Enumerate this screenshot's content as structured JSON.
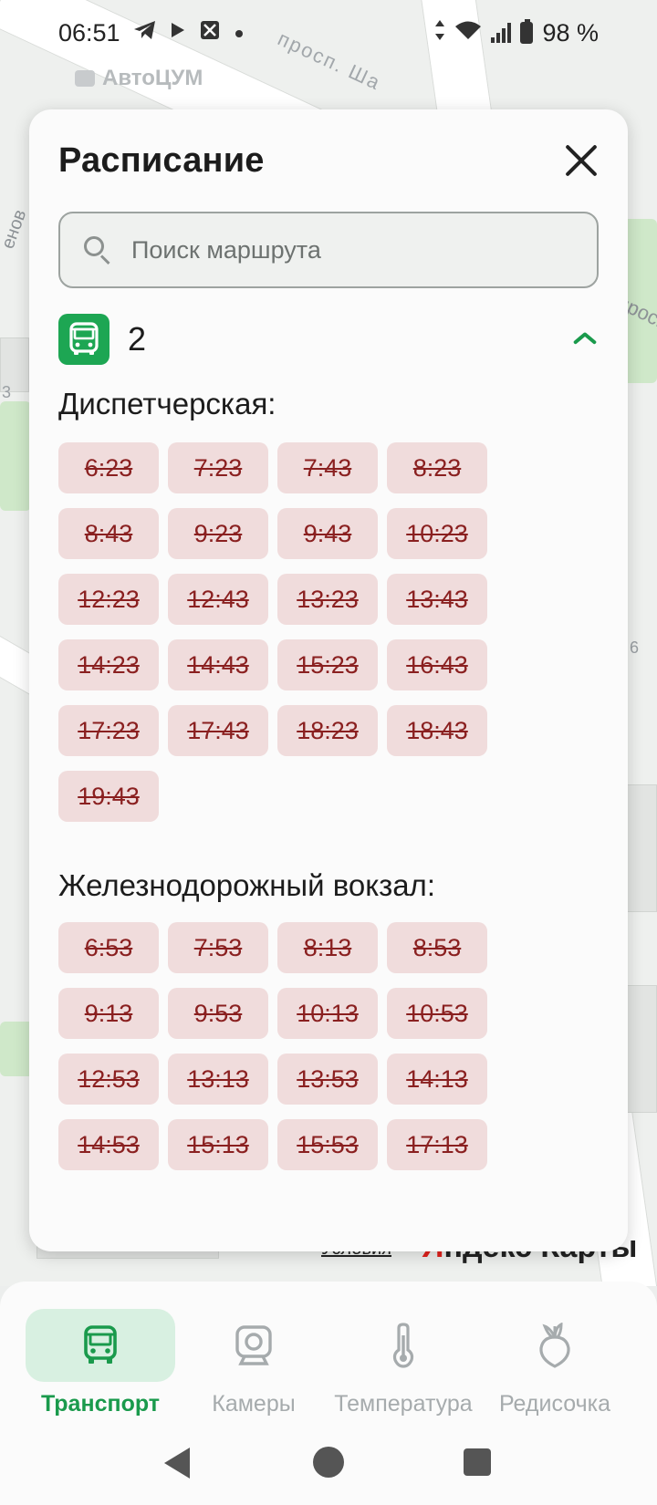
{
  "status_bar": {
    "time": "06:51",
    "battery": "98 %",
    "icons": [
      "telegram-icon",
      "play-icon",
      "crossed-box-icon",
      "dot-icon",
      "data-arrows-icon",
      "wifi-icon",
      "signal-icon",
      "battery-icon"
    ]
  },
  "map": {
    "poi_label": "АвтоЦУМ",
    "street_label": "просп. Ша",
    "left_label": "енов",
    "right_label": "просп",
    "num_left": "3",
    "num_right": "6",
    "attribution": "Условия",
    "brand": "Яндекс Карты"
  },
  "schedule": {
    "title": "Расписание",
    "search_placeholder": "Поиск маршрута",
    "route_number": "2",
    "stops": [
      {
        "name": "Диспетчерская:",
        "times": [
          "6:23",
          "7:23",
          "7:43",
          "8:23",
          "8:43",
          "9:23",
          "9:43",
          "10:23",
          "12:23",
          "12:43",
          "13:23",
          "13:43",
          "14:23",
          "14:43",
          "15:23",
          "16:43",
          "17:23",
          "17:43",
          "18:23",
          "18:43",
          "19:43"
        ]
      },
      {
        "name": "Железнодорожный вокзал:",
        "times": [
          "6:53",
          "7:53",
          "8:13",
          "8:53",
          "9:13",
          "9:53",
          "10:13",
          "10:53",
          "12:53",
          "13:13",
          "13:53",
          "14:13",
          "14:53",
          "15:13",
          "15:53",
          "17:13"
        ]
      }
    ]
  },
  "nav": {
    "items": [
      {
        "label": "Транспорт",
        "icon": "bus-icon",
        "active": true
      },
      {
        "label": "Камеры",
        "icon": "camera-icon",
        "active": false
      },
      {
        "label": "Температура",
        "icon": "thermometer-icon",
        "active": false
      },
      {
        "label": "Редисочка",
        "icon": "radish-icon",
        "active": false
      }
    ]
  },
  "colors": {
    "accent": "#1da653",
    "accent_text": "#1a9a4c",
    "chip_bg": "#f0dcdc",
    "chip_text": "#8a2020",
    "nav_active_bg": "#d8f0e1"
  }
}
